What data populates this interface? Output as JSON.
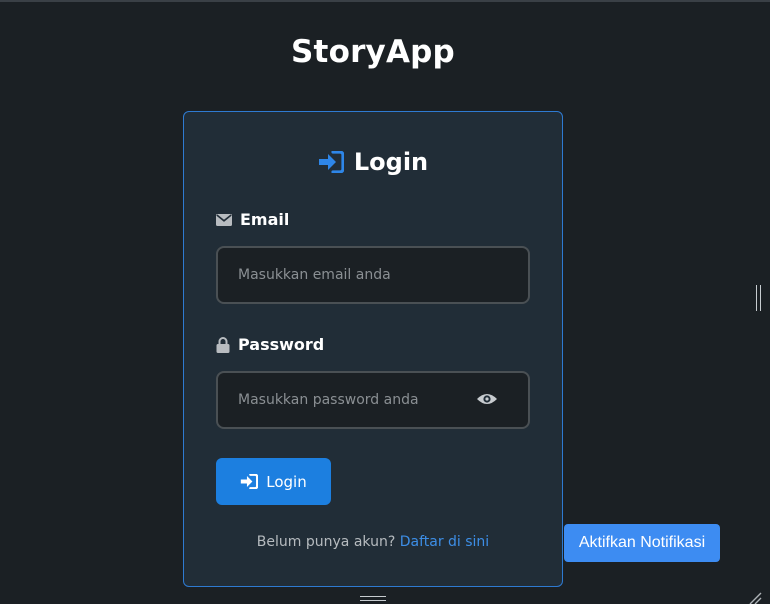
{
  "app": {
    "title": "StoryApp"
  },
  "login_card": {
    "title": "Login",
    "email": {
      "label": "Email",
      "placeholder": "Masukkan email anda",
      "value": ""
    },
    "password": {
      "label": "Password",
      "placeholder": "Masukkan password anda",
      "value": ""
    },
    "submit_label": "Login",
    "register": {
      "prompt": "Belum punya akun?",
      "link_text": "Daftar di sini"
    }
  },
  "notification_button": {
    "label": "Aktifkan Notifikasi"
  },
  "icons": {
    "card_title": "sign-in-icon",
    "email": "envelope-icon",
    "password": "lock-icon",
    "toggle_password": "eye-icon",
    "submit": "sign-in-icon"
  },
  "colors": {
    "background": "#1b2024",
    "card": "#212d37",
    "card_border": "#2e7ad1",
    "primary": "#1c7fe0",
    "link": "#3d8ee6",
    "notification": "#3d8cf2"
  }
}
